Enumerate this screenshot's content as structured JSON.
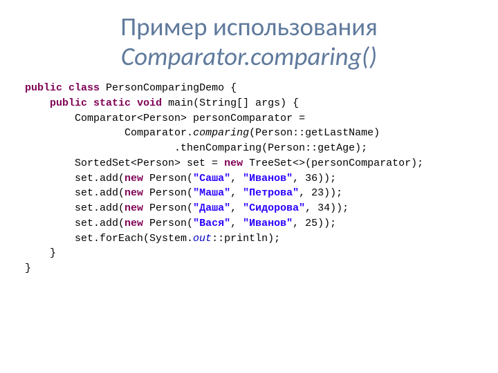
{
  "title": {
    "line1": "Пример использования",
    "line2": "Comparator.comparing()"
  },
  "code": {
    "kw_public": "public",
    "kw_class": "class",
    "kw_static": "static",
    "kw_void": "void",
    "kw_new": "new",
    "cls_name": " PersonComparingDemo {",
    "main_sig_post": " main(String[] args) {",
    "comparator_decl": "Comparator<Person> personComparator =",
    "comparing_pre": "Comparator.",
    "comparing_method": "comparing",
    "comparing_post": "(Person::getLastName)",
    "then_line": ".thenComparing(Person::getAge);",
    "sortedset_pre": "SortedSet<Person> set = ",
    "sortedset_post": " TreeSet<>(personComparator);",
    "add_pre": "set.add(",
    "person_pre": " Person(",
    "p1_first": "\"Саша\"",
    "p1_last": "\"Иванов\"",
    "p1_age": "36",
    "p2_first": "\"Маша\"",
    "p2_last": "\"Петрова\"",
    "p2_age": "23",
    "p3_first": "\"Даша\"",
    "p3_last": "\"Сидорова\"",
    "p3_age": "34",
    "p4_first": "\"Вася\"",
    "p4_last": "\"Иванов\"",
    "p4_age": "25",
    "add_close": "));",
    "sep": ", ",
    "foreach_pre": "set.forEach(System.",
    "out_field": "out",
    "foreach_post": "::println);",
    "brace_close": "}"
  }
}
